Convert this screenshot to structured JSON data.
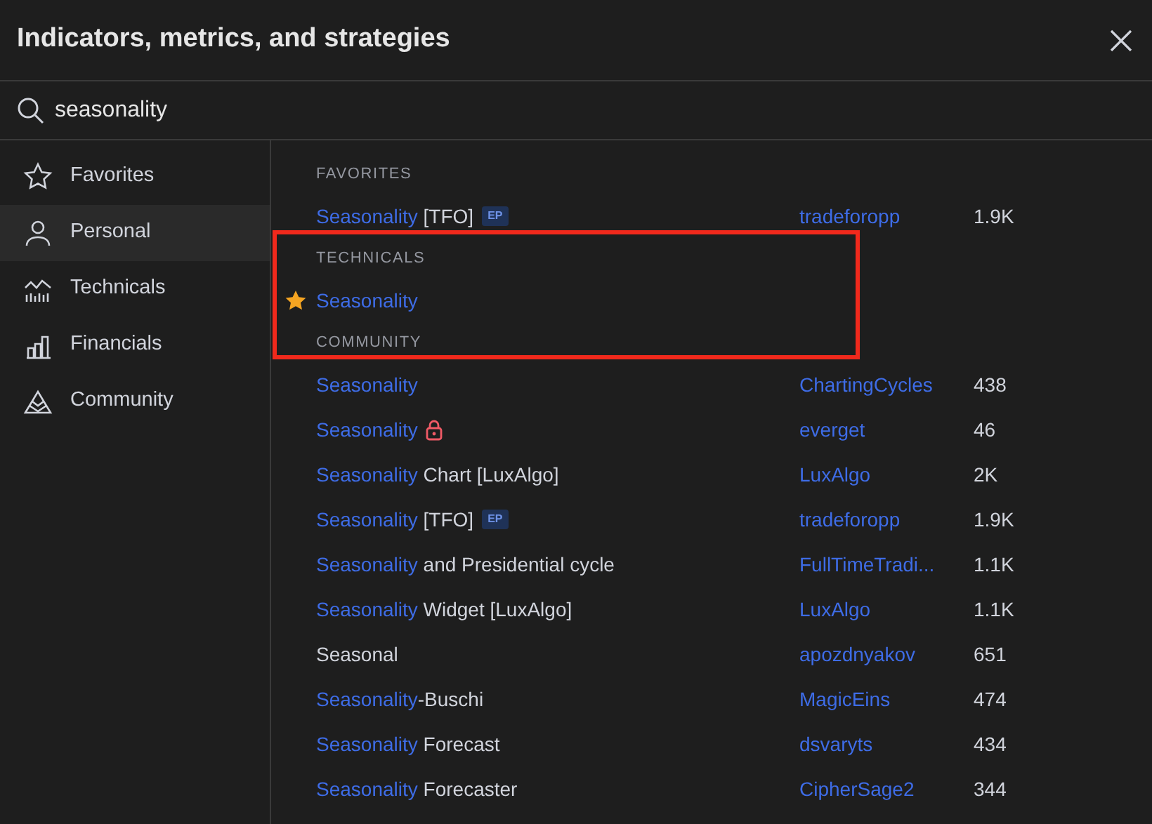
{
  "dialog": {
    "title": "Indicators, metrics, and strategies"
  },
  "search": {
    "value": "seasonality"
  },
  "sidebar": {
    "items": [
      {
        "label": "Favorites",
        "selected": false
      },
      {
        "label": "Personal",
        "selected": true
      },
      {
        "label": "Technicals",
        "selected": false
      },
      {
        "label": "Financials",
        "selected": false
      },
      {
        "label": "Community",
        "selected": false
      }
    ]
  },
  "sections": [
    {
      "heading": "FAVORITES",
      "highlighted": false,
      "rows": [
        {
          "name_parts": [
            {
              "text": "Seasonality",
              "match": true
            },
            {
              "text": " [TFO]",
              "match": false
            }
          ],
          "badge": "EP",
          "locked": false,
          "favorite": false,
          "author": "tradeforopp",
          "count": "1.9K"
        }
      ]
    },
    {
      "heading": "TECHNICALS",
      "highlighted": true,
      "rows": [
        {
          "name_parts": [
            {
              "text": "Seasonality",
              "match": true
            }
          ],
          "locked": false,
          "favorite": true
        }
      ]
    },
    {
      "heading": "COMMUNITY",
      "highlighted": false,
      "rows": [
        {
          "name_parts": [
            {
              "text": "Seasonality",
              "match": true
            }
          ],
          "locked": false,
          "favorite": false,
          "author": "ChartingCycles",
          "count": "438"
        },
        {
          "name_parts": [
            {
              "text": "Seasonality",
              "match": true
            }
          ],
          "locked": true,
          "favorite": false,
          "author": "everget",
          "count": "46"
        },
        {
          "name_parts": [
            {
              "text": "Seasonality",
              "match": true
            },
            {
              "text": " Chart [LuxAlgo]",
              "match": false
            }
          ],
          "locked": false,
          "favorite": false,
          "author": "LuxAlgo",
          "count": "2K"
        },
        {
          "name_parts": [
            {
              "text": "Seasonality",
              "match": true
            },
            {
              "text": " [TFO]",
              "match": false
            }
          ],
          "badge": "EP",
          "locked": false,
          "favorite": false,
          "author": "tradeforopp",
          "count": "1.9K"
        },
        {
          "name_parts": [
            {
              "text": "Seasonality",
              "match": true
            },
            {
              "text": " and Presidential cycle",
              "match": false
            }
          ],
          "locked": false,
          "favorite": false,
          "author": "FullTimeTradi...",
          "count": "1.1K"
        },
        {
          "name_parts": [
            {
              "text": "Seasonality",
              "match": true
            },
            {
              "text": " Widget [LuxAlgo]",
              "match": false
            }
          ],
          "locked": false,
          "favorite": false,
          "author": "LuxAlgo",
          "count": "1.1K"
        },
        {
          "name_parts": [
            {
              "text": "Seasonal",
              "match": false
            }
          ],
          "locked": false,
          "favorite": false,
          "author": "apozdnyakov",
          "count": "651"
        },
        {
          "name_parts": [
            {
              "text": "Seasonality",
              "match": true
            },
            {
              "text": "-Buschi",
              "match": false
            }
          ],
          "locked": false,
          "favorite": false,
          "author": "MagicEins",
          "count": "474"
        },
        {
          "name_parts": [
            {
              "text": "Seasonality",
              "match": true
            },
            {
              "text": " Forecast",
              "match": false
            }
          ],
          "locked": false,
          "favorite": false,
          "author": "dsvaryts",
          "count": "434"
        },
        {
          "name_parts": [
            {
              "text": "Seasonality",
              "match": true
            },
            {
              "text": " Forecaster",
              "match": false
            }
          ],
          "locked": false,
          "favorite": false,
          "author": "CipherSage2",
          "count": "344"
        }
      ]
    }
  ]
}
